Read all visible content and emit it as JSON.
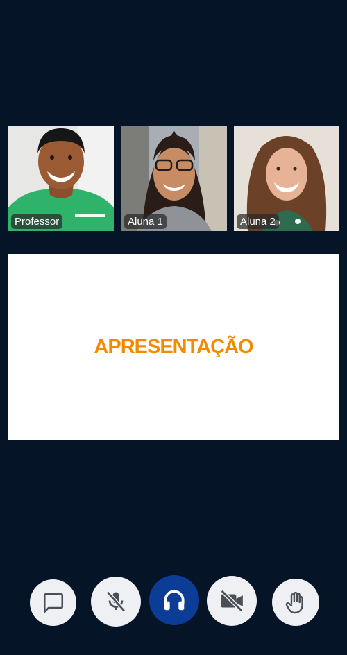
{
  "participants": [
    {
      "name": "Professor"
    },
    {
      "name": "Aluna 1"
    },
    {
      "name": "Aluna 2"
    }
  ],
  "presentation": {
    "title": "APRESENTAÇÃO"
  },
  "controls": {
    "chat": "chat-icon",
    "microphone": "mic-off-icon",
    "audio": "headphones-icon",
    "camera": "video-off-icon",
    "raise_hand": "raise-hand-icon"
  },
  "colors": {
    "background": "#061428",
    "accent": "#0b3c96",
    "slide_title": "#f28b00",
    "button_bg": "#eef0f3"
  }
}
